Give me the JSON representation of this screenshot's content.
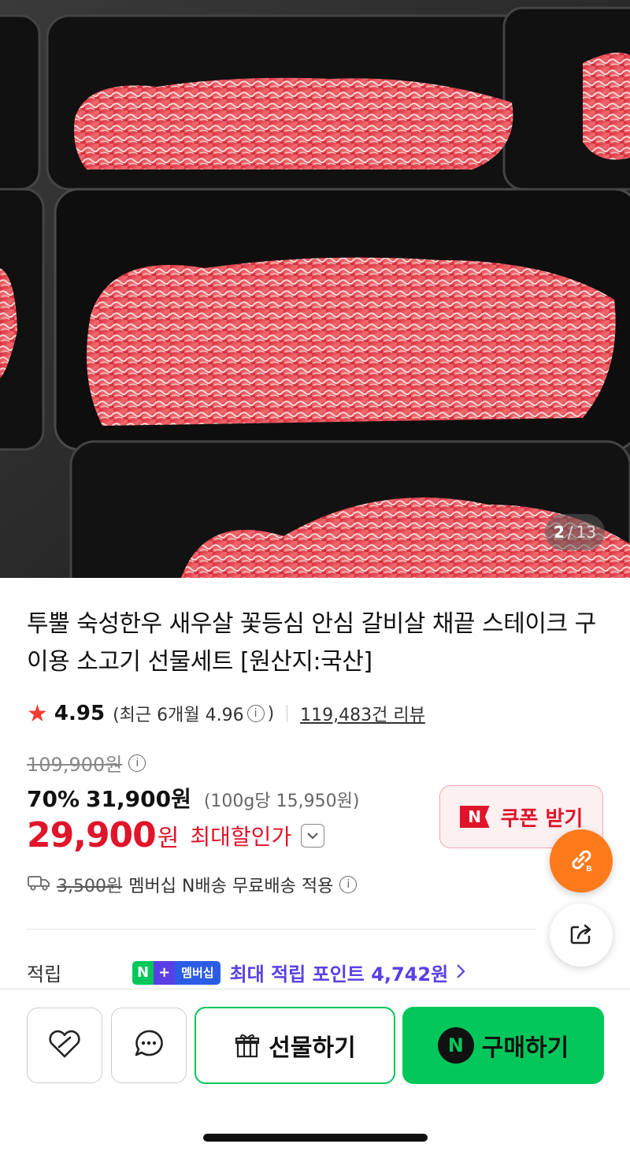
{
  "gallery": {
    "current": "2",
    "separator": "/",
    "total": "13"
  },
  "product": {
    "title": "투뿔 숙성한우 새우살 꽃등심 안심 갈비살 채끝 스테이크 구이용 소고기 선물세트 [원산지:국산]"
  },
  "rating": {
    "score": "4.95",
    "recent_label": "(최근 6개월 4.96",
    "recent_close": ")",
    "reviews": "119,483건 리뷰"
  },
  "price": {
    "original": "109,900원",
    "discount_percent": "70%",
    "discount_price": "31,900원",
    "unit_price": "(100g당 15,950원)",
    "final_amount": "29,900",
    "final_currency": "원",
    "final_label": "최대할인가"
  },
  "coupon": {
    "logo": "N",
    "label": "쿠폰 받기"
  },
  "shipping": {
    "original_fee": "3,500원",
    "text": "멤버십 N배송 무료배송 적용"
  },
  "points": {
    "label": "적립",
    "badge_n": "N",
    "badge_plus": "+",
    "badge_member": "멤버십",
    "text": "최대 적립 포인트 4,742원"
  },
  "actions": {
    "gift_label": "선물하기",
    "buy_logo": "N",
    "buy_label": "구매하기"
  },
  "colors": {
    "accent_red": "#e0142a",
    "naver_green": "#03c75a",
    "points_purple": "#5b3fe6",
    "fab_orange": "#ff7a1a"
  },
  "icons": [
    "star-icon",
    "info-icon",
    "dropdown-chevron-icon",
    "truck-icon",
    "link-icon",
    "share-icon",
    "heart-icon",
    "chat-icon",
    "gift-icon",
    "chevron-right-icon"
  ]
}
